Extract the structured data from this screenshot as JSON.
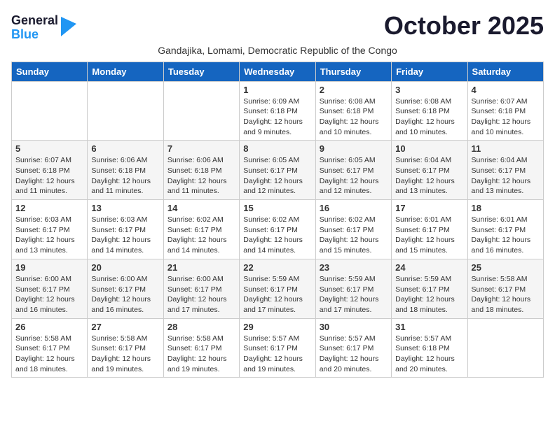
{
  "logo": {
    "general": "General",
    "blue": "Blue"
  },
  "month": "October 2025",
  "subtitle": "Gandajika, Lomami, Democratic Republic of the Congo",
  "days_of_week": [
    "Sunday",
    "Monday",
    "Tuesday",
    "Wednesday",
    "Thursday",
    "Friday",
    "Saturday"
  ],
  "weeks": [
    [
      {
        "day": "",
        "info": ""
      },
      {
        "day": "",
        "info": ""
      },
      {
        "day": "",
        "info": ""
      },
      {
        "day": "1",
        "info": "Sunrise: 6:09 AM\nSunset: 6:18 PM\nDaylight: 12 hours\nand 9 minutes."
      },
      {
        "day": "2",
        "info": "Sunrise: 6:08 AM\nSunset: 6:18 PM\nDaylight: 12 hours\nand 10 minutes."
      },
      {
        "day": "3",
        "info": "Sunrise: 6:08 AM\nSunset: 6:18 PM\nDaylight: 12 hours\nand 10 minutes."
      },
      {
        "day": "4",
        "info": "Sunrise: 6:07 AM\nSunset: 6:18 PM\nDaylight: 12 hours\nand 10 minutes."
      }
    ],
    [
      {
        "day": "5",
        "info": "Sunrise: 6:07 AM\nSunset: 6:18 PM\nDaylight: 12 hours\nand 11 minutes."
      },
      {
        "day": "6",
        "info": "Sunrise: 6:06 AM\nSunset: 6:18 PM\nDaylight: 12 hours\nand 11 minutes."
      },
      {
        "day": "7",
        "info": "Sunrise: 6:06 AM\nSunset: 6:18 PM\nDaylight: 12 hours\nand 11 minutes."
      },
      {
        "day": "8",
        "info": "Sunrise: 6:05 AM\nSunset: 6:17 PM\nDaylight: 12 hours\nand 12 minutes."
      },
      {
        "day": "9",
        "info": "Sunrise: 6:05 AM\nSunset: 6:17 PM\nDaylight: 12 hours\nand 12 minutes."
      },
      {
        "day": "10",
        "info": "Sunrise: 6:04 AM\nSunset: 6:17 PM\nDaylight: 12 hours\nand 13 minutes."
      },
      {
        "day": "11",
        "info": "Sunrise: 6:04 AM\nSunset: 6:17 PM\nDaylight: 12 hours\nand 13 minutes."
      }
    ],
    [
      {
        "day": "12",
        "info": "Sunrise: 6:03 AM\nSunset: 6:17 PM\nDaylight: 12 hours\nand 13 minutes."
      },
      {
        "day": "13",
        "info": "Sunrise: 6:03 AM\nSunset: 6:17 PM\nDaylight: 12 hours\nand 14 minutes."
      },
      {
        "day": "14",
        "info": "Sunrise: 6:02 AM\nSunset: 6:17 PM\nDaylight: 12 hours\nand 14 minutes."
      },
      {
        "day": "15",
        "info": "Sunrise: 6:02 AM\nSunset: 6:17 PM\nDaylight: 12 hours\nand 14 minutes."
      },
      {
        "day": "16",
        "info": "Sunrise: 6:02 AM\nSunset: 6:17 PM\nDaylight: 12 hours\nand 15 minutes."
      },
      {
        "day": "17",
        "info": "Sunrise: 6:01 AM\nSunset: 6:17 PM\nDaylight: 12 hours\nand 15 minutes."
      },
      {
        "day": "18",
        "info": "Sunrise: 6:01 AM\nSunset: 6:17 PM\nDaylight: 12 hours\nand 16 minutes."
      }
    ],
    [
      {
        "day": "19",
        "info": "Sunrise: 6:00 AM\nSunset: 6:17 PM\nDaylight: 12 hours\nand 16 minutes."
      },
      {
        "day": "20",
        "info": "Sunrise: 6:00 AM\nSunset: 6:17 PM\nDaylight: 12 hours\nand 16 minutes."
      },
      {
        "day": "21",
        "info": "Sunrise: 6:00 AM\nSunset: 6:17 PM\nDaylight: 12 hours\nand 17 minutes."
      },
      {
        "day": "22",
        "info": "Sunrise: 5:59 AM\nSunset: 6:17 PM\nDaylight: 12 hours\nand 17 minutes."
      },
      {
        "day": "23",
        "info": "Sunrise: 5:59 AM\nSunset: 6:17 PM\nDaylight: 12 hours\nand 17 minutes."
      },
      {
        "day": "24",
        "info": "Sunrise: 5:59 AM\nSunset: 6:17 PM\nDaylight: 12 hours\nand 18 minutes."
      },
      {
        "day": "25",
        "info": "Sunrise: 5:58 AM\nSunset: 6:17 PM\nDaylight: 12 hours\nand 18 minutes."
      }
    ],
    [
      {
        "day": "26",
        "info": "Sunrise: 5:58 AM\nSunset: 6:17 PM\nDaylight: 12 hours\nand 18 minutes."
      },
      {
        "day": "27",
        "info": "Sunrise: 5:58 AM\nSunset: 6:17 PM\nDaylight: 12 hours\nand 19 minutes."
      },
      {
        "day": "28",
        "info": "Sunrise: 5:58 AM\nSunset: 6:17 PM\nDaylight: 12 hours\nand 19 minutes."
      },
      {
        "day": "29",
        "info": "Sunrise: 5:57 AM\nSunset: 6:17 PM\nDaylight: 12 hours\nand 19 minutes."
      },
      {
        "day": "30",
        "info": "Sunrise: 5:57 AM\nSunset: 6:17 PM\nDaylight: 12 hours\nand 20 minutes."
      },
      {
        "day": "31",
        "info": "Sunrise: 5:57 AM\nSunset: 6:18 PM\nDaylight: 12 hours\nand 20 minutes."
      },
      {
        "day": "",
        "info": ""
      }
    ]
  ]
}
